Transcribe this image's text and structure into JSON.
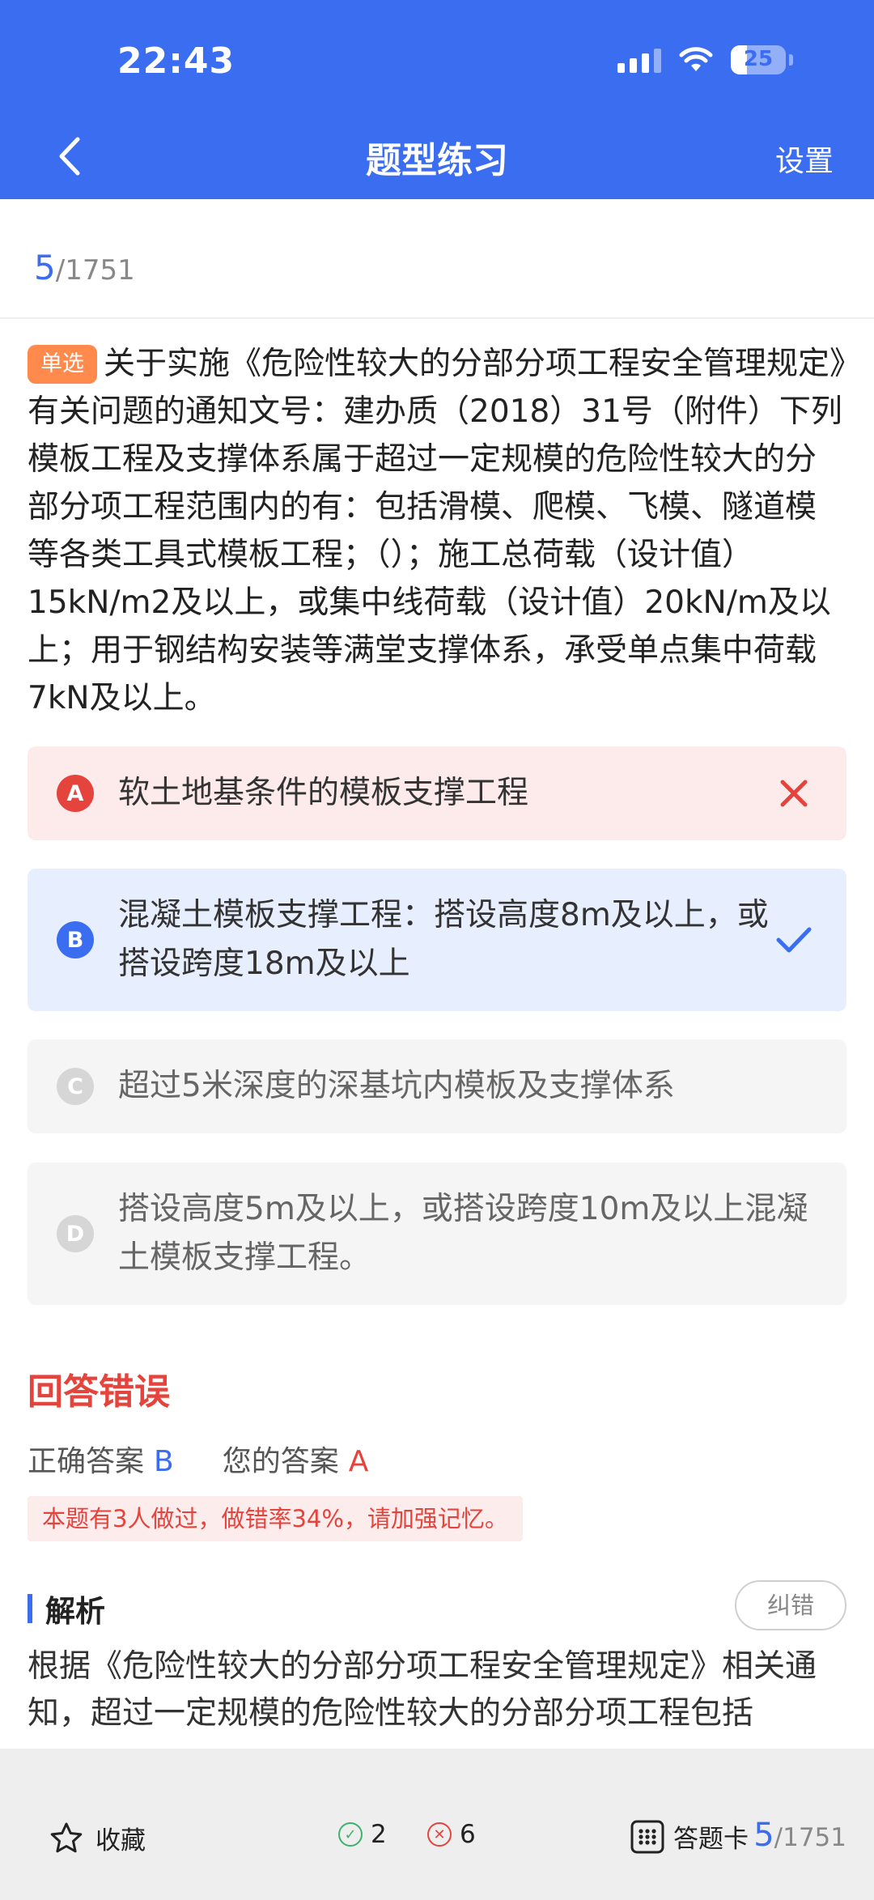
{
  "status": {
    "time": "22:43",
    "battery": "25"
  },
  "header": {
    "title": "题型练习",
    "settings": "设置"
  },
  "progress": {
    "current": "5",
    "total": "/1751"
  },
  "question": {
    "tag": "单选",
    "text": "关于实施《危险性较大的分部分项工程安全管理规定》有关问题的通知文号：建办质（2018）31号（附件）下列模板工程及支撑体系属于超过一定规模的危险性较大的分部分项工程范围内的有：包括滑模、爬模、飞模、隧道模等各类工具式模板工程；（）；施工总荷载（设计值）15kN/m2及以上，或集中线荷载（设计值）20kN/m及以上；用于钢结构安装等满堂支撑体系，承受单点集中荷载7kN及以上。"
  },
  "options": [
    {
      "letter": "A",
      "text": "软土地基条件的模板支撑工程",
      "state": "wrong"
    },
    {
      "letter": "B",
      "text": "混凝土模板支撑工程：搭设高度8m及以上，或搭设跨度18m及以上",
      "state": "correct"
    },
    {
      "letter": "C",
      "text": "超过5米深度的深基坑内模板及支撑体系",
      "state": "normal"
    },
    {
      "letter": "D",
      "text": "搭设高度5m及以上，或搭设跨度10m及以上混凝土模板支撑工程。",
      "state": "normal"
    }
  ],
  "result": {
    "title": "回答错误",
    "correct_label": "正确答案",
    "correct_value": "B",
    "your_label": "您的答案",
    "your_value": "A",
    "stat": "本题有3人做过，做错率34%，请加强记忆。"
  },
  "analysis": {
    "title": "解析",
    "correct_button": "纠错",
    "text": "根据《危险性较大的分部分项工程安全管理规定》相关通知，超过一定规模的危险性较大的分部分项工程包括"
  },
  "bottom": {
    "favorite": "收藏",
    "right_count": "2",
    "wrong_count": "6",
    "answer_card": "答题卡",
    "current": "5",
    "total": "/1751"
  },
  "colors": {
    "primary": "#3a6df0",
    "error": "#e5443d",
    "success": "#3bb36b",
    "tag": "#ff8a4c"
  }
}
